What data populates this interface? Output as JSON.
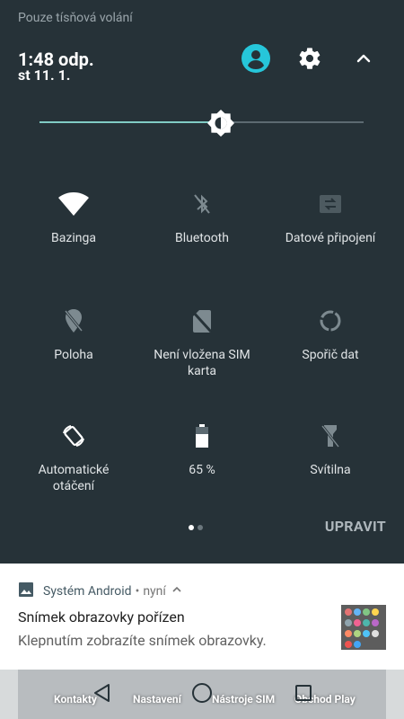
{
  "header": {
    "status_text": "Pouze tísňová volání",
    "time": "1:48 odp.",
    "date": "st 11. 1."
  },
  "brightness": {
    "level": 0.56
  },
  "tiles": [
    {
      "label": "Bazinga",
      "icon": "wifi-icon"
    },
    {
      "label": "Bluetooth",
      "icon": "bluetooth-off-icon"
    },
    {
      "label": "Datové připojení",
      "icon": "data-connection-icon"
    },
    {
      "label": "Poloha",
      "icon": "location-off-icon"
    },
    {
      "label": "Není vložena SIM karta",
      "icon": "no-sim-icon"
    },
    {
      "label": "Spořič dat",
      "icon": "data-saver-icon"
    },
    {
      "label": "Automatické otáčení",
      "icon": "auto-rotate-icon"
    },
    {
      "label": "65 %",
      "icon": "battery-icon"
    },
    {
      "label": "Svítilna",
      "icon": "flashlight-off-icon"
    }
  ],
  "pager": {
    "pages": 2,
    "current": 1
  },
  "edit_label": "UPRAVIT",
  "notification": {
    "app": "Systém Android",
    "separator": "•",
    "time": "nyní",
    "title": "Snímek obrazovky pořízen",
    "text": "Klepnutím zobrazíte snímek obrazovky."
  },
  "background_apps": [
    "Kontakty",
    "Nastavení",
    "Nástroje SIM",
    "Obchod Play"
  ],
  "colors": {
    "panel": "#263238",
    "accent": "#26c6da",
    "slider": "#80cbc4"
  }
}
